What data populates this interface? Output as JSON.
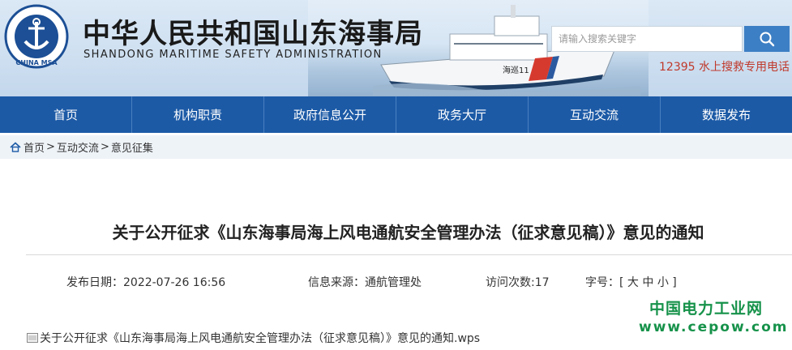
{
  "header": {
    "title_cn": "中华人民共和国山东海事局",
    "title_en": "SHANDONG MARITIME SAFETY ADMINISTRATION",
    "logo_text": "CHINA MSA",
    "ship_text": "海巡11",
    "search_placeholder": "请输入搜索关键字",
    "hotline_number": "12395",
    "hotline_label": " 水上搜救专用电话"
  },
  "nav": {
    "items": [
      "首页",
      "机构职责",
      "政府信息公开",
      "政务大厅",
      "互动交流",
      "数据发布"
    ]
  },
  "breadcrumb": {
    "home": "首页",
    "sep": ">",
    "level1": "互动交流",
    "level2": "意见征集"
  },
  "article": {
    "title": "关于公开征求《山东海事局海上风电通航安全管理办法（征求意见稿）》意见的通知",
    "publish_date": "发布日期：2022-07-26  16:56",
    "source": "信息来源：通航管理处",
    "visits": "访问次数:17",
    "font_label": "字号：[",
    "font_large": "大",
    "font_medium": "中",
    "font_small": "小",
    "font_close": "]",
    "attachment": "关于公开征求《山东海事局海上风电通航安全管理办法（征求意见稿）》意见的通知.wps"
  },
  "watermark": {
    "line1": "中国电力工业网",
    "line2": "www.cepow.com"
  },
  "colors": {
    "nav_bg": "#1c5aa6",
    "search_btn": "#3d7fc4",
    "hotline": "#c0392b",
    "watermark": "#16924a"
  }
}
